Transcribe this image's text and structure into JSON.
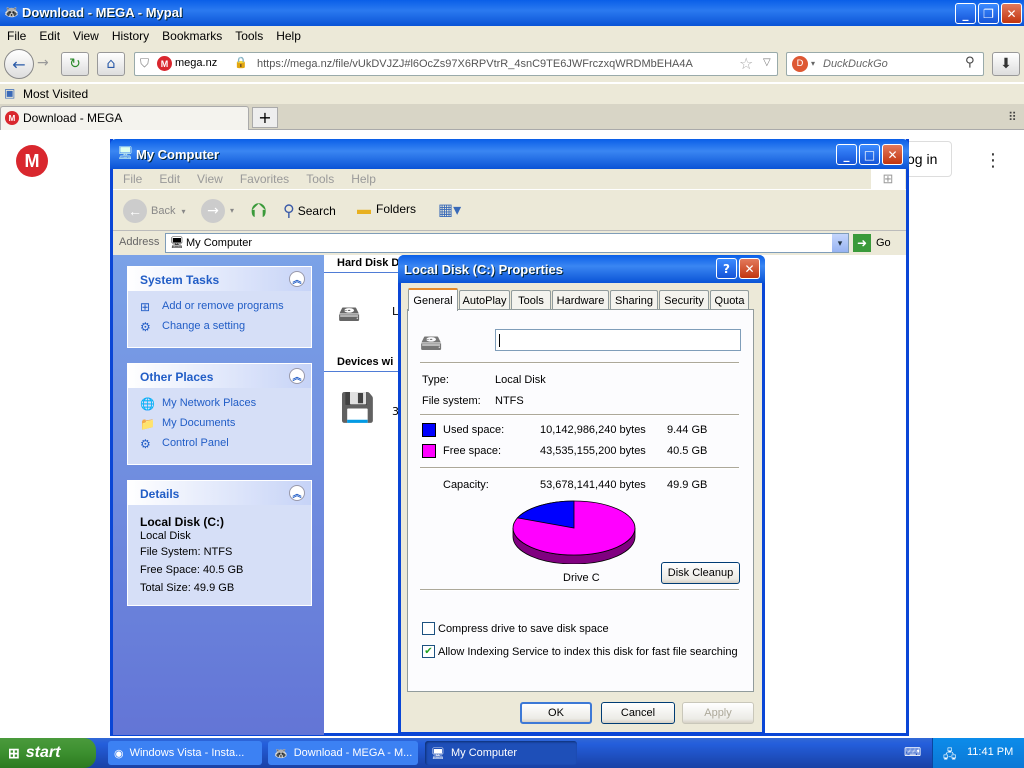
{
  "browser": {
    "title": "Download - MEGA - Mypal",
    "menu": [
      "File",
      "Edit",
      "View",
      "History",
      "Bookmarks",
      "Tools",
      "Help"
    ],
    "site_identity": "mega.nz",
    "url": "https://mega.nz/file/vUkDVJZJ#l6OcZs97X6RPVtrR_4snC9TE6JWFrczxqWRDMbEHA4A",
    "search_placeholder": "DuckDuckGo",
    "bookmark": "Most Visited",
    "tab_title": "Download - MEGA",
    "new_tab": "+",
    "page_login_fragment": "og in"
  },
  "explorer": {
    "title": "My Computer",
    "menu": [
      "File",
      "Edit",
      "View",
      "Favorites",
      "Tools",
      "Help"
    ],
    "toolbar": {
      "back": "Back",
      "search": "Search",
      "folders": "Folders"
    },
    "address_label": "Address",
    "address_value": "My Computer",
    "go": "Go",
    "system_tasks": {
      "title": "System Tasks",
      "items": [
        "Add or remove programs",
        "Change a setting"
      ]
    },
    "other_places": {
      "title": "Other Places",
      "items": [
        "My Network Places",
        "My Documents",
        "Control Panel"
      ]
    },
    "details": {
      "title": "Details",
      "name": "Local Disk (C:)",
      "lines": [
        "Local Disk",
        "File System: NTFS",
        "Free Space: 40.5 GB",
        "Total Size: 49.9 GB"
      ]
    },
    "group_hard_disks": "Hard Disk D",
    "group_devices": "Devices wi",
    "drive_item_fragment": "L",
    "floppy_item_fragment": "3"
  },
  "dialog": {
    "title": "Local Disk (C:) Properties",
    "tabs": [
      "General",
      "AutoPlay",
      "Tools",
      "Hardware",
      "Sharing",
      "Security",
      "Quota"
    ],
    "active_tab": "General",
    "label_value": "",
    "type_label": "Type:",
    "type_value": "Local Disk",
    "fs_label": "File system:",
    "fs_value": "NTFS",
    "used_label": "Used space:",
    "used_bytes": "10,142,986,240 bytes",
    "used_gb": "9.44 GB",
    "free_label": "Free space:",
    "free_bytes": "43,535,155,200 bytes",
    "free_gb": "40.5 GB",
    "capacity_label": "Capacity:",
    "capacity_bytes": "53,678,141,440 bytes",
    "capacity_gb": "49.9 GB",
    "drive_label": "Drive C",
    "disk_cleanup": "Disk Cleanup",
    "compress_label": "Compress drive to save disk space",
    "compress_checked": false,
    "index_label": "Allow Indexing Service to index this disk for fast file searching",
    "index_checked": true,
    "ok": "OK",
    "cancel": "Cancel",
    "apply": "Apply",
    "used_fraction": 0.189,
    "colors": {
      "used": "#0000ff",
      "free": "#ff00ff"
    }
  },
  "taskbar": {
    "start": "start",
    "tasks": [
      "Windows Vista - Insta...",
      "Download - MEGA - M...",
      "My Computer"
    ],
    "clock": "11:41 PM"
  }
}
